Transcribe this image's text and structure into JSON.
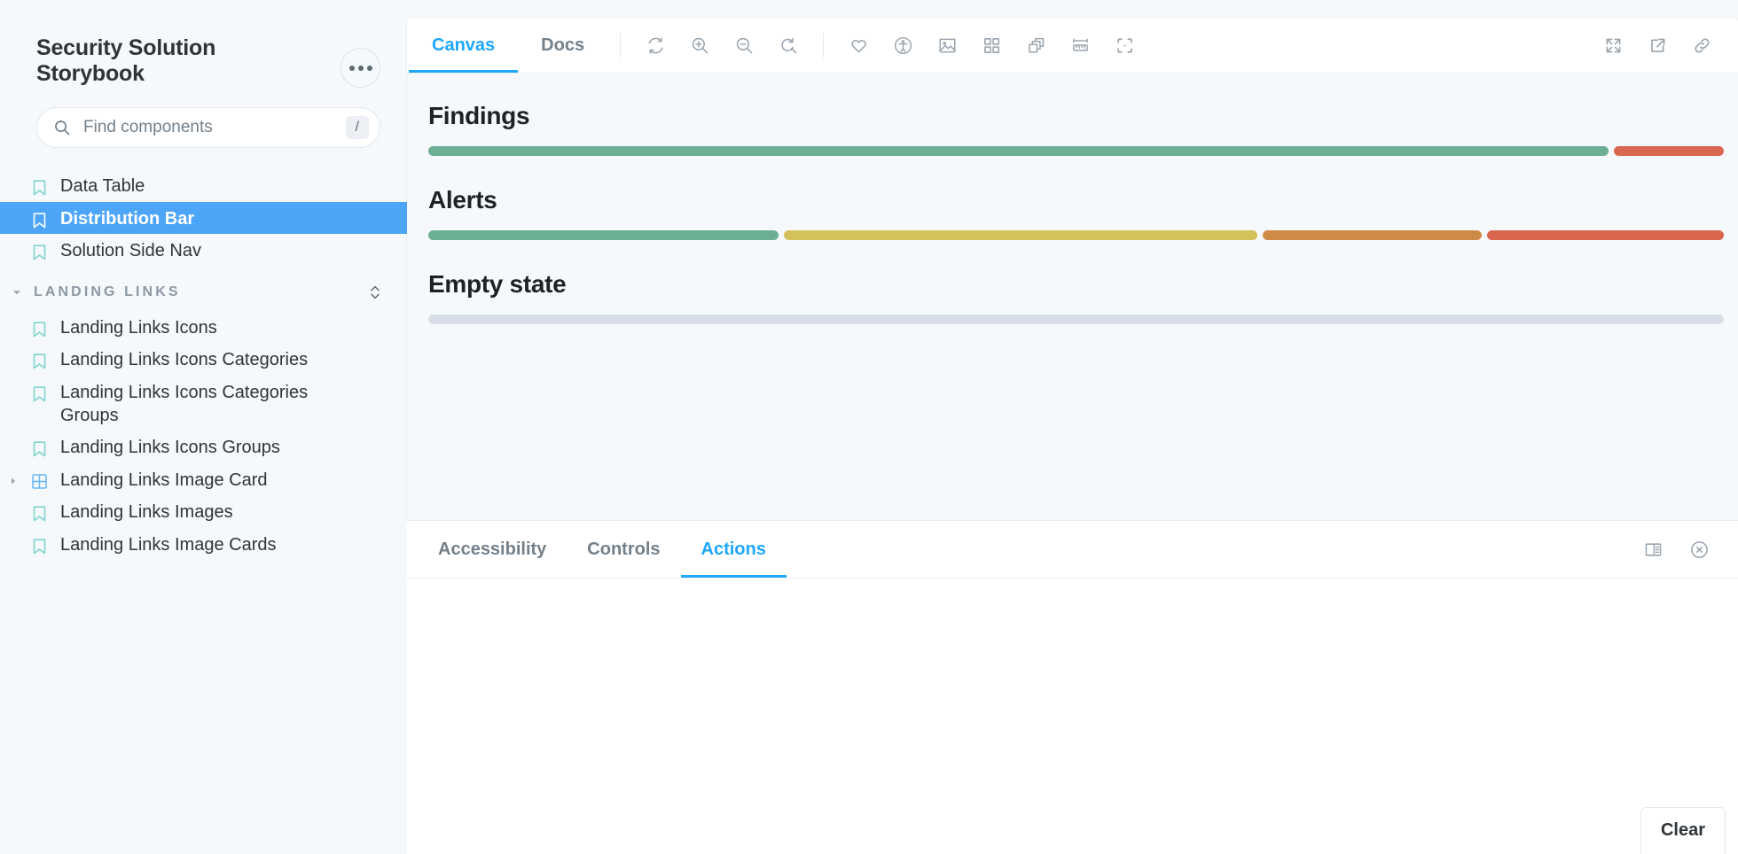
{
  "sidebar": {
    "title": "Security Solution Storybook",
    "menu_button": "...",
    "search": {
      "placeholder": "Find components",
      "value": "",
      "shortcut_key": "/"
    },
    "items": [
      {
        "label": "Data Table",
        "icon": "bookmark-icon",
        "selected": false,
        "expandable": false
      },
      {
        "label": "Distribution Bar",
        "icon": "bookmark-icon",
        "selected": true,
        "expandable": false
      },
      {
        "label": "Solution Side Nav",
        "icon": "bookmark-icon",
        "selected": false,
        "expandable": false
      }
    ],
    "group": {
      "label": "LANDING LINKS",
      "expanded": true,
      "items": [
        {
          "label": "Landing Links Icons",
          "icon": "bookmark-icon",
          "selected": false,
          "expandable": false
        },
        {
          "label": "Landing Links Icons Categories",
          "icon": "bookmark-icon",
          "selected": false,
          "expandable": false
        },
        {
          "label": "Landing Links Icons Categories Groups",
          "icon": "bookmark-icon",
          "selected": false,
          "expandable": false
        },
        {
          "label": "Landing Links Icons Groups",
          "icon": "bookmark-icon",
          "selected": false,
          "expandable": false
        },
        {
          "label": "Landing Links Image Card",
          "icon": "component-grid-icon",
          "selected": false,
          "expandable": true
        },
        {
          "label": "Landing Links Images",
          "icon": "bookmark-icon",
          "selected": false,
          "expandable": false
        },
        {
          "label": "Landing Links Image Cards",
          "icon": "bookmark-icon",
          "selected": false,
          "expandable": false
        }
      ]
    }
  },
  "toolbar": {
    "tabs": [
      {
        "label": "Canvas",
        "active": true
      },
      {
        "label": "Docs",
        "active": false
      }
    ],
    "icons": [
      "remount-icon",
      "zoom-in-icon",
      "zoom-out-icon",
      "zoom-reset-icon",
      "heart-icon",
      "accessibility-icon",
      "background-image-icon",
      "grid-icon",
      "layers-icon",
      "ruler-icon",
      "outline-icon"
    ],
    "right_icons": [
      "fullscreen-icon",
      "open-new-tab-icon",
      "copy-link-icon"
    ]
  },
  "canvas": {
    "stories": [
      {
        "title": "Findings"
      },
      {
        "title": "Alerts"
      },
      {
        "title": "Empty state"
      }
    ]
  },
  "addon": {
    "tabs": [
      {
        "label": "Accessibility",
        "active": false
      },
      {
        "label": "Controls",
        "active": false
      },
      {
        "label": "Actions",
        "active": true
      }
    ],
    "right_icons": [
      "panel-position-icon",
      "close-panel-icon"
    ],
    "clear_label": "Clear"
  },
  "colors": {
    "accent_blue": "#1ea7fd",
    "selected_blue": "#4da5f7",
    "bookmark_teal": "#7fd4d0",
    "green": "#6daf94",
    "yellow": "#d5c159",
    "orange": "#d08a47",
    "red": "#d9674f",
    "empty_gray": "#d8dee5"
  },
  "chart_data": [
    {
      "type": "bar",
      "title": "Findings",
      "orientation": "horizontal-stacked",
      "categories": [
        "segment-1",
        "segment-2"
      ],
      "values": [
        91.5,
        8.5
      ],
      "colors": [
        "#6daf94",
        "#d9674f"
      ],
      "total": 100,
      "xlabel": "",
      "ylabel": "",
      "grid": false,
      "legend": "none"
    },
    {
      "type": "bar",
      "title": "Alerts",
      "orientation": "horizontal-stacked",
      "categories": [
        "segment-1",
        "segment-2",
        "segment-3",
        "segment-4"
      ],
      "values": [
        27.4,
        37.0,
        17.1,
        18.5
      ],
      "colors": [
        "#6daf94",
        "#d5c159",
        "#d08a47",
        "#d9674f"
      ],
      "total": 100,
      "xlabel": "",
      "ylabel": "",
      "grid": false,
      "legend": "none"
    },
    {
      "type": "bar",
      "title": "Empty state",
      "orientation": "horizontal-stacked",
      "categories": [
        "empty"
      ],
      "values": [
        100
      ],
      "colors": [
        "#d8dee5"
      ],
      "total": 100,
      "xlabel": "",
      "ylabel": "",
      "grid": false,
      "legend": "none"
    }
  ]
}
